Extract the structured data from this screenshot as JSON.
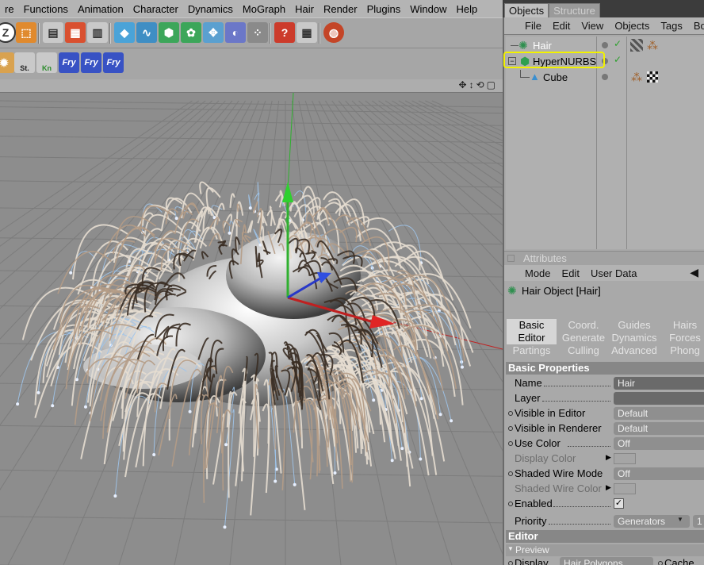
{
  "menubar": [
    "re",
    "Functions",
    "Animation",
    "Character",
    "Dynamics",
    "MoGraph",
    "Hair",
    "Render",
    "Plugins",
    "Window",
    "Help"
  ],
  "toolbar2_labels": {
    "st": "St.",
    "kn": "Kn",
    "fry1": "Fry",
    "fry2": "Fry",
    "fry3": "Fry"
  },
  "objects_panel": {
    "tabs": [
      "Objects",
      "Structure"
    ],
    "menu": [
      "File",
      "Edit",
      "View",
      "Objects",
      "Tags",
      "Bo"
    ],
    "items": [
      {
        "name": "Hair"
      },
      {
        "name": "HyperNURBS"
      },
      {
        "name": "Cube"
      }
    ]
  },
  "attributes": {
    "title": "Attributes",
    "menu": [
      "Mode",
      "Edit",
      "User Data"
    ],
    "object_label": "Hair Object [Hair]",
    "tabs": [
      [
        "Basic",
        "Coord.",
        "Guides",
        "Hairs"
      ],
      [
        "Editor",
        "Generate",
        "Dynamics",
        "Forces"
      ],
      [
        "Partings",
        "Culling",
        "Advanced",
        "Phong"
      ]
    ],
    "section_basic": "Basic Properties",
    "props": [
      {
        "label": "Name",
        "value": "Hair"
      },
      {
        "label": "Layer",
        "value": ""
      },
      {
        "label": "Visible in Editor",
        "value": "Default"
      },
      {
        "label": "Visible in Renderer",
        "value": "Default"
      },
      {
        "label": "Use Color",
        "value": "Off"
      },
      {
        "label": "Display Color",
        "value": ""
      },
      {
        "label": "Shaded Wire Mode",
        "value": "Off"
      },
      {
        "label": "Shaded Wire Color",
        "value": ""
      },
      {
        "label": "Enabled",
        "value": "✓"
      }
    ],
    "priority_label": "Priority",
    "priority_value": "Generators",
    "priority_num": "1",
    "section_editor": "Editor",
    "preview_label": "Preview",
    "display_label": "Display",
    "display_value": "Hair Polygons",
    "cache_label": "Cache"
  },
  "colors": {
    "highlight": "#f2f200",
    "hair_light": "#e6ddd0",
    "hair_dark": "#3a2e24",
    "guides": "#9fc4ea"
  }
}
